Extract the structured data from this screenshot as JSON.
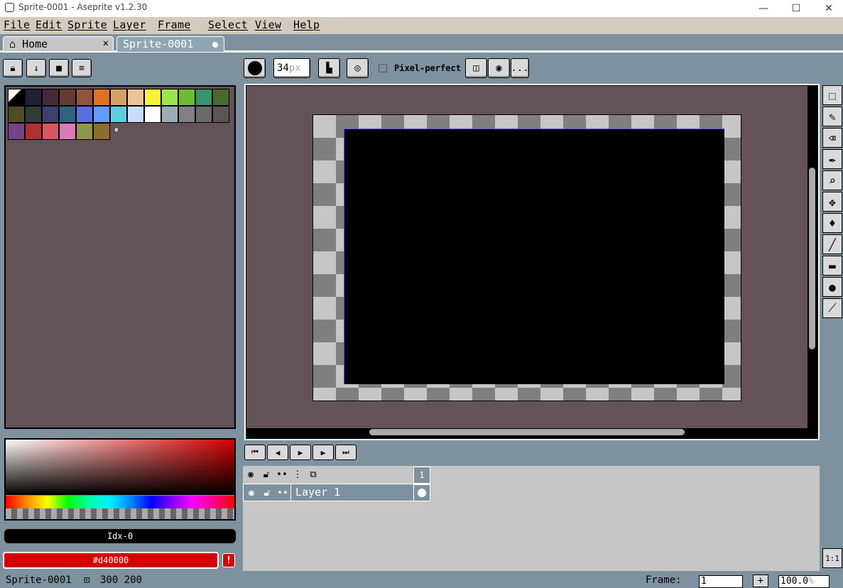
{
  "window": {
    "title": "Sprite-0001 - Aseprite v1.2.30",
    "minimize": "—",
    "maximize": "☐",
    "close": "✕"
  },
  "menu": {
    "items": [
      "File",
      "Edit",
      "Sprite",
      "Layer",
      "Frame",
      "Select",
      "View",
      "Help"
    ]
  },
  "tabs": [
    {
      "label": "Home",
      "close": "✕"
    },
    {
      "label": "Sprite-0001"
    }
  ],
  "palette": {
    "rows": [
      [
        "#000000",
        "#222034",
        "#45283c",
        "#663931",
        "#8f563b",
        "#df7126",
        "#d9a066",
        "#eec39a",
        "#fbf236",
        "#99e550",
        "#6abe30",
        "#37946e",
        "#4b692f"
      ],
      [
        "#524b24",
        "#323c39",
        "#3f3f74",
        "#306082",
        "#5b6ee1",
        "#639bff",
        "#5fcde4",
        "#cbdbfc",
        "#ffffff",
        "#9badb7",
        "#847e87",
        "#696a6a",
        "#595652"
      ],
      [
        "#76428a",
        "#ac3232",
        "#d95763",
        "#d77bba",
        "#8f974a",
        "#8a6f30"
      ]
    ]
  },
  "color": {
    "index_label": "Idx-0",
    "hex_label": "#d40000",
    "warning": "!"
  },
  "toolbar": {
    "brush_size": "34",
    "brush_unit": "px",
    "pixel_perfect": "Pixel-perfect",
    "more": "..."
  },
  "timeline": {
    "frame_number": "1",
    "layer_name": "Layer 1"
  },
  "status": {
    "sprite_name": "Sprite-0001",
    "dimensions": "300 200",
    "frame_label": "Frame:",
    "frame_value": "1",
    "zoom": "100.0",
    "zoom_unit": "%"
  },
  "zoom_reset": "1:1",
  "colors": {
    "workspace": "#7d929e",
    "editor_bg": "#635358",
    "primary": "#d40000"
  }
}
